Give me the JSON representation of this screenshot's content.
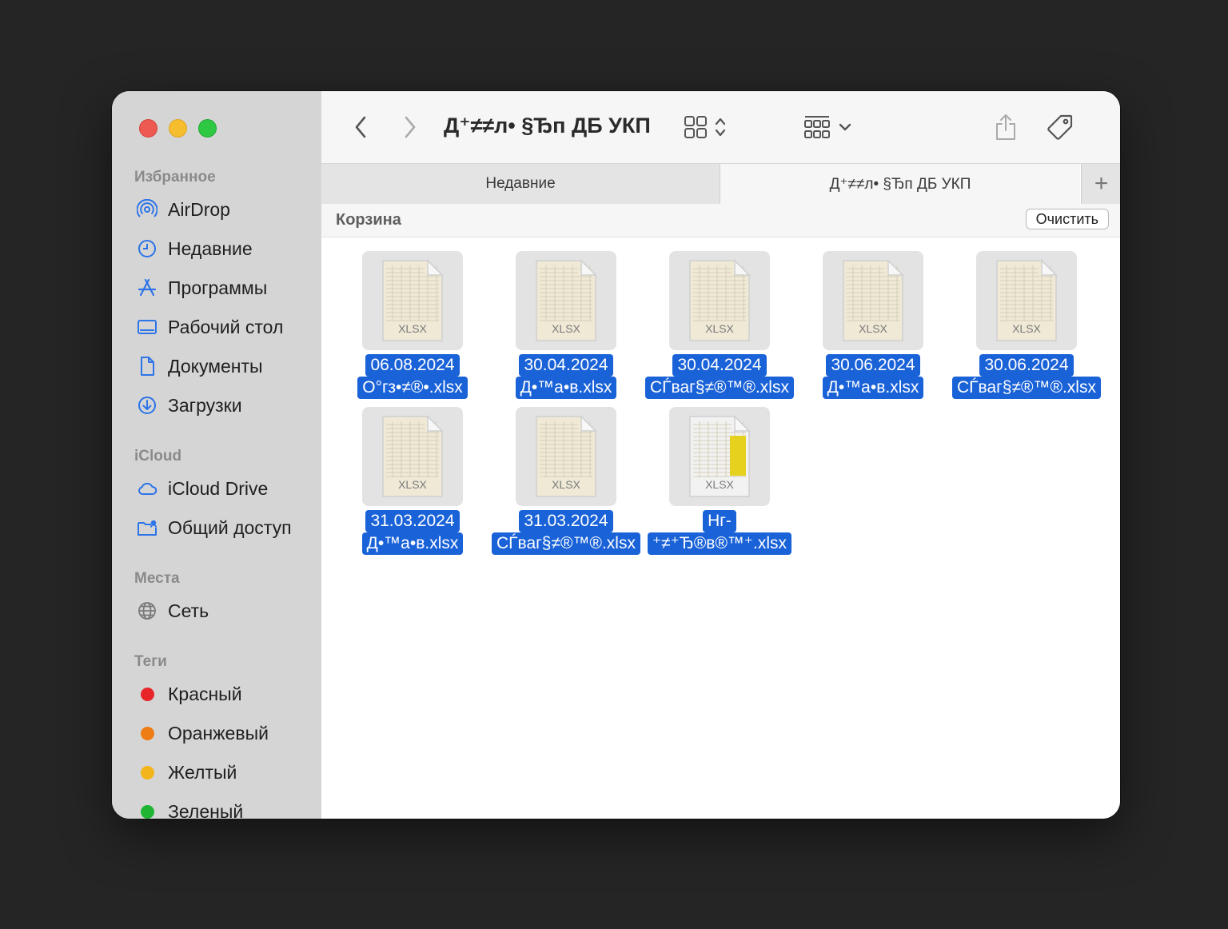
{
  "window": {
    "title": "Д⁺≠≠л• §Ђп ДБ УКП"
  },
  "sidebar": {
    "sections": [
      {
        "title": "Избранное",
        "items": [
          {
            "label": "AirDrop",
            "icon": "airdrop-icon"
          },
          {
            "label": "Недавние",
            "icon": "clock-icon"
          },
          {
            "label": "Программы",
            "icon": "apps-icon"
          },
          {
            "label": "Рабочий стол",
            "icon": "desktop-icon"
          },
          {
            "label": "Документы",
            "icon": "document-icon"
          },
          {
            "label": "Загрузки",
            "icon": "download-icon"
          }
        ]
      },
      {
        "title": "iCloud",
        "items": [
          {
            "label": "iCloud Drive",
            "icon": "cloud-icon"
          },
          {
            "label": "Общий доступ",
            "icon": "shared-folder-icon"
          }
        ]
      },
      {
        "title": "Места",
        "items": [
          {
            "label": "Сеть",
            "icon": "globe-icon"
          }
        ]
      },
      {
        "title": "Теги",
        "items": [
          {
            "label": "Красный",
            "color": "#e8262a"
          },
          {
            "label": "Оранжевый",
            "color": "#f07c16"
          },
          {
            "label": "Желтый",
            "color": "#f2b51b"
          },
          {
            "label": "Зеленый",
            "color": "#1fb533"
          }
        ]
      }
    ]
  },
  "tabs": [
    {
      "label": "Недавние",
      "active": false
    },
    {
      "label": "Д⁺≠≠л• §Ђп ДБ УКП",
      "active": true
    }
  ],
  "pathbar": {
    "title": "Корзина",
    "clear_label": "Очистить"
  },
  "files": [
    {
      "line1": "06.08.2024",
      "line2": "О°гз•≠®•.xlsx",
      "badge": "XLSX"
    },
    {
      "line1": "30.04.2024",
      "line2": "Д•™а•в.xlsx",
      "badge": "XLSX"
    },
    {
      "line1": "30.04.2024",
      "line2": "СЃваг§≠®™®.xlsx",
      "badge": "XLSX"
    },
    {
      "line1": "30.06.2024",
      "line2": "Д•™а•в.xlsx",
      "badge": "XLSX"
    },
    {
      "line1": "30.06.2024",
      "line2": "СЃваг§≠®™®.xlsx",
      "badge": "XLSX"
    },
    {
      "line1": "31.03.2024",
      "line2": "Д•™а•в.xlsx",
      "badge": "XLSX"
    },
    {
      "line1": "31.03.2024",
      "line2": "СЃваг§≠®™®.xlsx",
      "badge": "XLSX"
    },
    {
      "line1": "Нг-",
      "line2": "⁺≠⁺Ђ®в®™⁺.xlsx",
      "badge": "XLSX"
    }
  ],
  "colors": {
    "selection": "#1a62d8",
    "sidebar_icon": "#2d74e8"
  }
}
